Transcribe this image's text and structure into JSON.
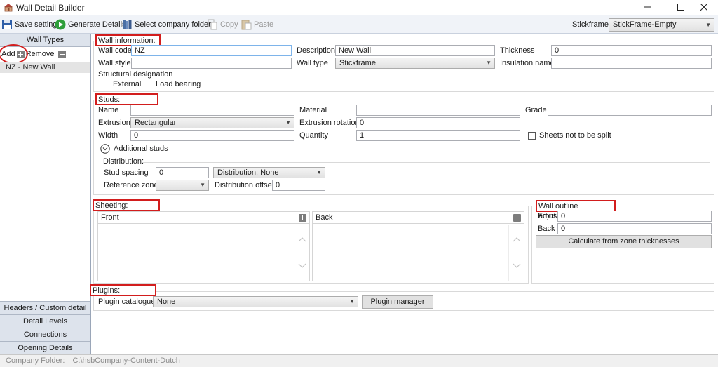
{
  "window": {
    "title": "Wall Detail Builder"
  },
  "toolbar": {
    "save_settings": "Save settings",
    "generate_details": "Generate Details",
    "select_company_folder": "Select company folder",
    "copy": "Copy",
    "paste": "Paste",
    "stickframe_label": "Stickframe:",
    "stickframe_value": "StickFrame-Empty"
  },
  "left_panel": {
    "header": "Wall Types",
    "add": "Add",
    "remove": "Remove",
    "items": [
      "NZ - New Wall"
    ],
    "bottom_tabs": [
      "Headers / Custom detail",
      "Detail Levels",
      "Connections",
      "Opening Details"
    ]
  },
  "wall_information": {
    "title": "Wall information:",
    "wall_code_label": "Wall code",
    "wall_code_value": "NZ",
    "description_label": "Description",
    "description_value": "New Wall",
    "thickness_label": "Thickness",
    "thickness_value": "0",
    "wall_style_label": "Wall style",
    "wall_style_value": "",
    "wall_type_label": "Wall type",
    "wall_type_value": "Stickframe",
    "insulation_name_label": "Insulation name",
    "insulation_name_value": "",
    "structural_designation_label": "Structural designation",
    "external_label": "External",
    "load_bearing_label": "Load bearing"
  },
  "studs": {
    "title": "Studs:",
    "name_label": "Name",
    "name_value": "",
    "material_label": "Material",
    "material_value": "",
    "grade_label": "Grade",
    "grade_value": "",
    "extrusion_label": "Extrusion",
    "extrusion_value": "Rectangular",
    "extrusion_rotation_label": "Extrusion rotation",
    "extrusion_rotation_value": "0",
    "width_label": "Width",
    "width_value": "0",
    "quantity_label": "Quantity",
    "quantity_value": "1",
    "sheets_not_split_label": "Sheets not to be split",
    "additional_studs_label": "Additional studs",
    "distribution_label": "Distribution:",
    "stud_spacing_label": "Stud spacing",
    "stud_spacing_value": "0",
    "distribution_value": "Distribution: None",
    "reference_zones_label": "Reference zones",
    "reference_zones_value": "",
    "distribution_offset_label": "Distribution offset",
    "distribution_offset_value": "0"
  },
  "sheeting": {
    "title": "Sheeting:",
    "front_label": "Front",
    "back_label": "Back"
  },
  "wall_outline": {
    "title": "Wall outline adjustments:",
    "front_label": "Front",
    "front_value": "0",
    "back_label": "Back",
    "back_value": "0",
    "calculate_button": "Calculate from zone thicknesses"
  },
  "plugins": {
    "title": "Plugins:",
    "catalogue_label": "Plugin catalogue",
    "catalogue_value": "None",
    "manager_button": "Plugin manager"
  },
  "status_bar": {
    "company_folder_label": "Company Folder:",
    "company_folder_value": "C:\\hsbCompany-Content-Dutch"
  },
  "colors": {
    "highlight_red": "#d21d1d",
    "toolbar_bg": "#f0f3f8",
    "panel_header_bg": "#dde3ec"
  }
}
